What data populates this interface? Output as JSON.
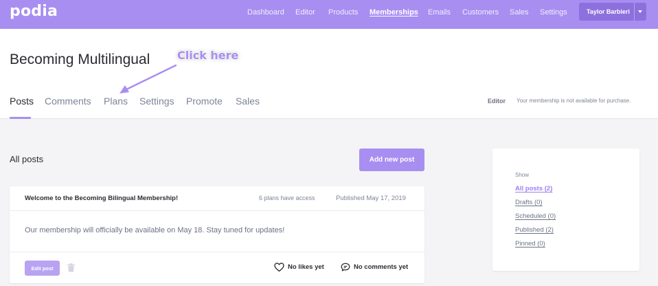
{
  "app": {
    "logo": "podia"
  },
  "nav": {
    "items": [
      {
        "label": "Dashboard"
      },
      {
        "label": "Editor"
      },
      {
        "label": "Products"
      },
      {
        "label": "Memberships"
      },
      {
        "label": "Emails"
      },
      {
        "label": "Customers"
      },
      {
        "label": "Sales"
      },
      {
        "label": "Settings"
      }
    ],
    "active": "Memberships",
    "user_name": "Taylor Barbieri"
  },
  "header": {
    "title": "Becoming Multilingual",
    "tabs": [
      {
        "label": "Posts"
      },
      {
        "label": "Comments"
      },
      {
        "label": "Plans"
      },
      {
        "label": "Settings"
      },
      {
        "label": "Promote"
      },
      {
        "label": "Sales"
      }
    ],
    "active_tab": "Posts",
    "editor_label": "Editor",
    "availability_note": "Your membership is not available for purchase."
  },
  "annotation": {
    "text": "Click here",
    "color": "#a88ef0"
  },
  "main": {
    "section_title": "All posts",
    "add_button": "Add new post",
    "posts": [
      {
        "title": "Welcome to the Becoming Bilingual Membership!",
        "access": "6 plans have access",
        "published": "Published May 17, 2019",
        "body": "Our membership will officially be available on May 18. Stay tuned for updates!",
        "edit_label": "Edit post",
        "likes": "No likes yet",
        "comments": "No comments yet"
      }
    ]
  },
  "sidebar": {
    "show_label": "Show",
    "filters": [
      {
        "label": "All posts (2)",
        "active": true
      },
      {
        "label": "Drafts (0)",
        "active": false
      },
      {
        "label": "Scheduled (0)",
        "active": false
      },
      {
        "label": "Published (2)",
        "active": false
      },
      {
        "label": "Pinned (0)",
        "active": false
      }
    ]
  },
  "colors": {
    "brand": "#a88ef0",
    "user_button": "#8d70de",
    "page_background": "#f4f4f6"
  },
  "icons": [
    "trash-icon",
    "heart-icon",
    "comment-icon",
    "chevron-down-icon"
  ]
}
